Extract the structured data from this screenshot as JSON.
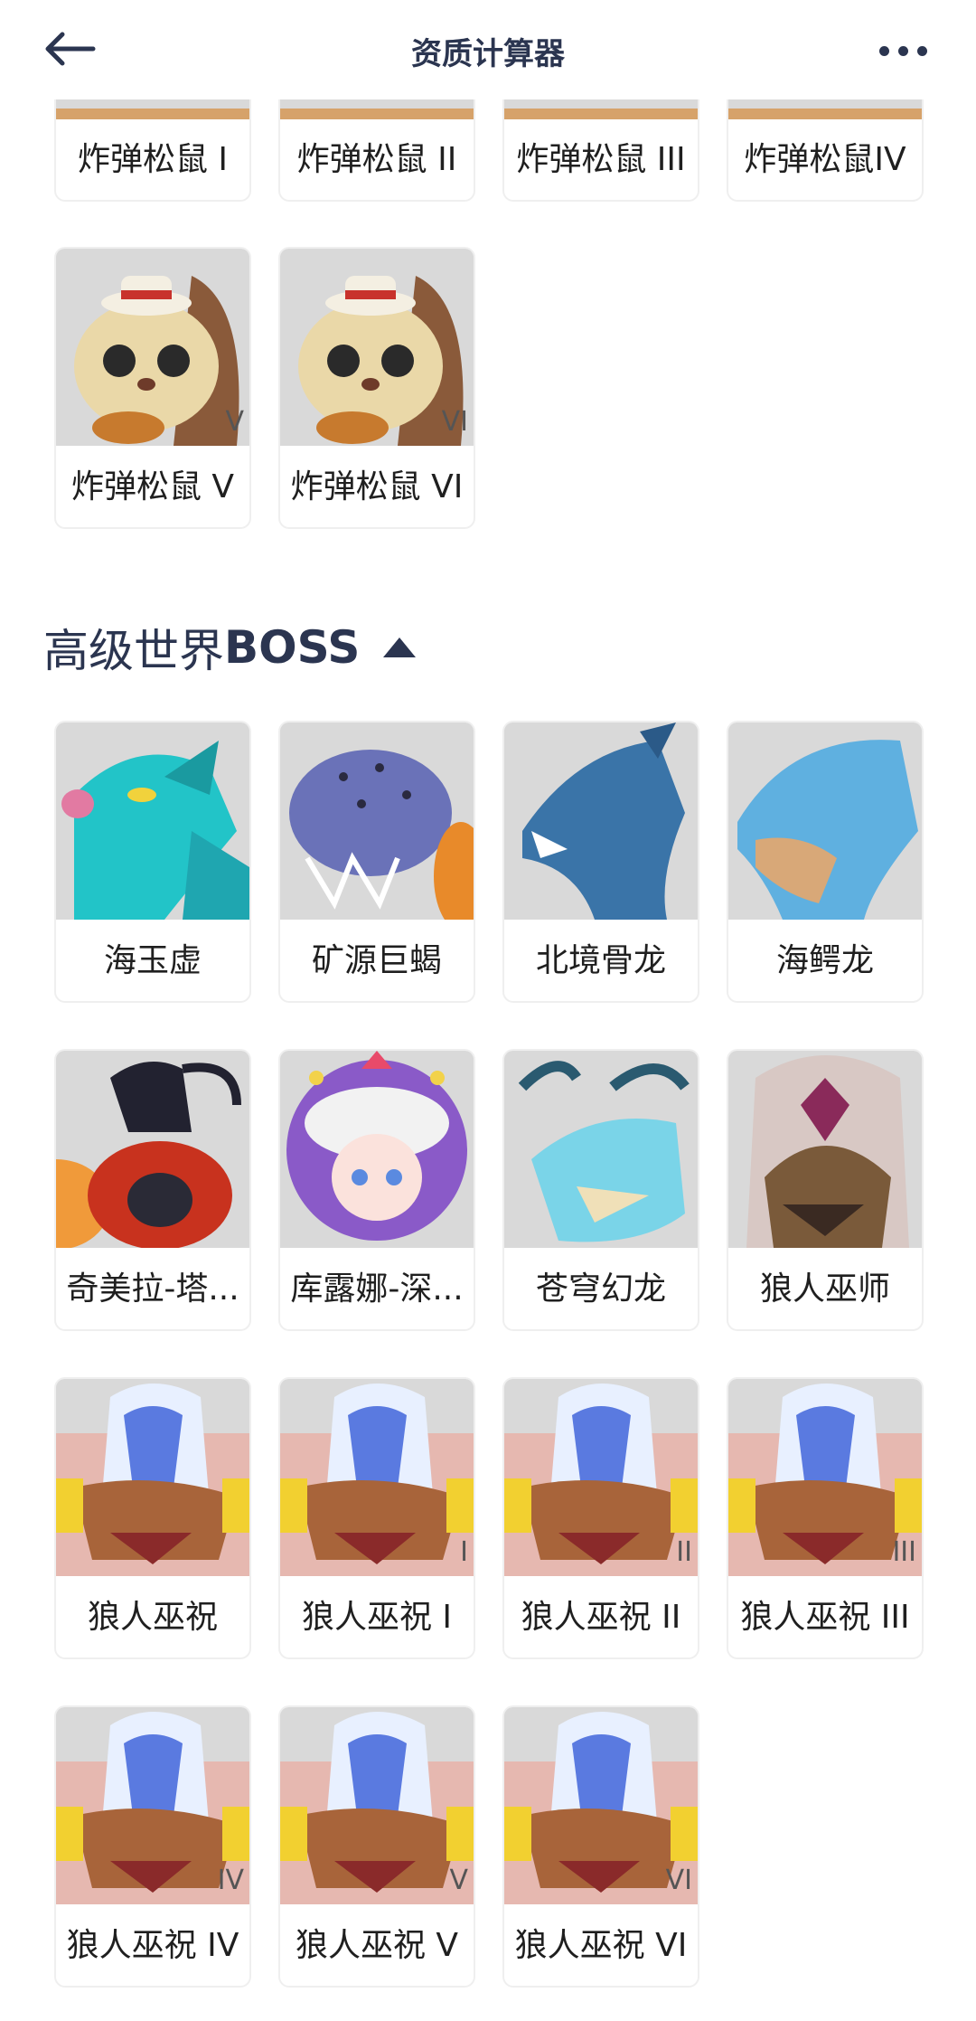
{
  "header": {
    "title": "资质计算器"
  },
  "squirrel_section": {
    "top_row": [
      {
        "name": "炸弹松鼠 I"
      },
      {
        "name": "炸弹松鼠 II"
      },
      {
        "name": "炸弹松鼠 III"
      },
      {
        "name": "炸弹松鼠IV"
      }
    ],
    "second_row": [
      {
        "name": "炸弹松鼠 V",
        "tier": "V"
      },
      {
        "name": "炸弹松鼠 VI",
        "tier": "VI"
      }
    ]
  },
  "boss_section": {
    "title_cn": "高级世界",
    "title_en": "BOSS",
    "cards": [
      {
        "name": "海玉虚"
      },
      {
        "name": "矿源巨蝎"
      },
      {
        "name": "北境骨龙"
      },
      {
        "name": "海鳄龙"
      },
      {
        "name": "奇美拉-塔..."
      },
      {
        "name": "库露娜-深..."
      },
      {
        "name": "苍穹幻龙"
      },
      {
        "name": "狼人巫师"
      },
      {
        "name": "狼人巫祝",
        "tier": ""
      },
      {
        "name": "狼人巫祝 I",
        "tier": "I"
      },
      {
        "name": "狼人巫祝 II",
        "tier": "II"
      },
      {
        "name": "狼人巫祝 III",
        "tier": "III"
      },
      {
        "name": "狼人巫祝 IV",
        "tier": "IV"
      },
      {
        "name": "狼人巫祝 V",
        "tier": "V"
      },
      {
        "name": "狼人巫祝 VI",
        "tier": "VI"
      }
    ]
  },
  "colors": {
    "title": "#2b3550",
    "card_border": "#efefef",
    "portrait_bg": "#d9d9d9"
  }
}
